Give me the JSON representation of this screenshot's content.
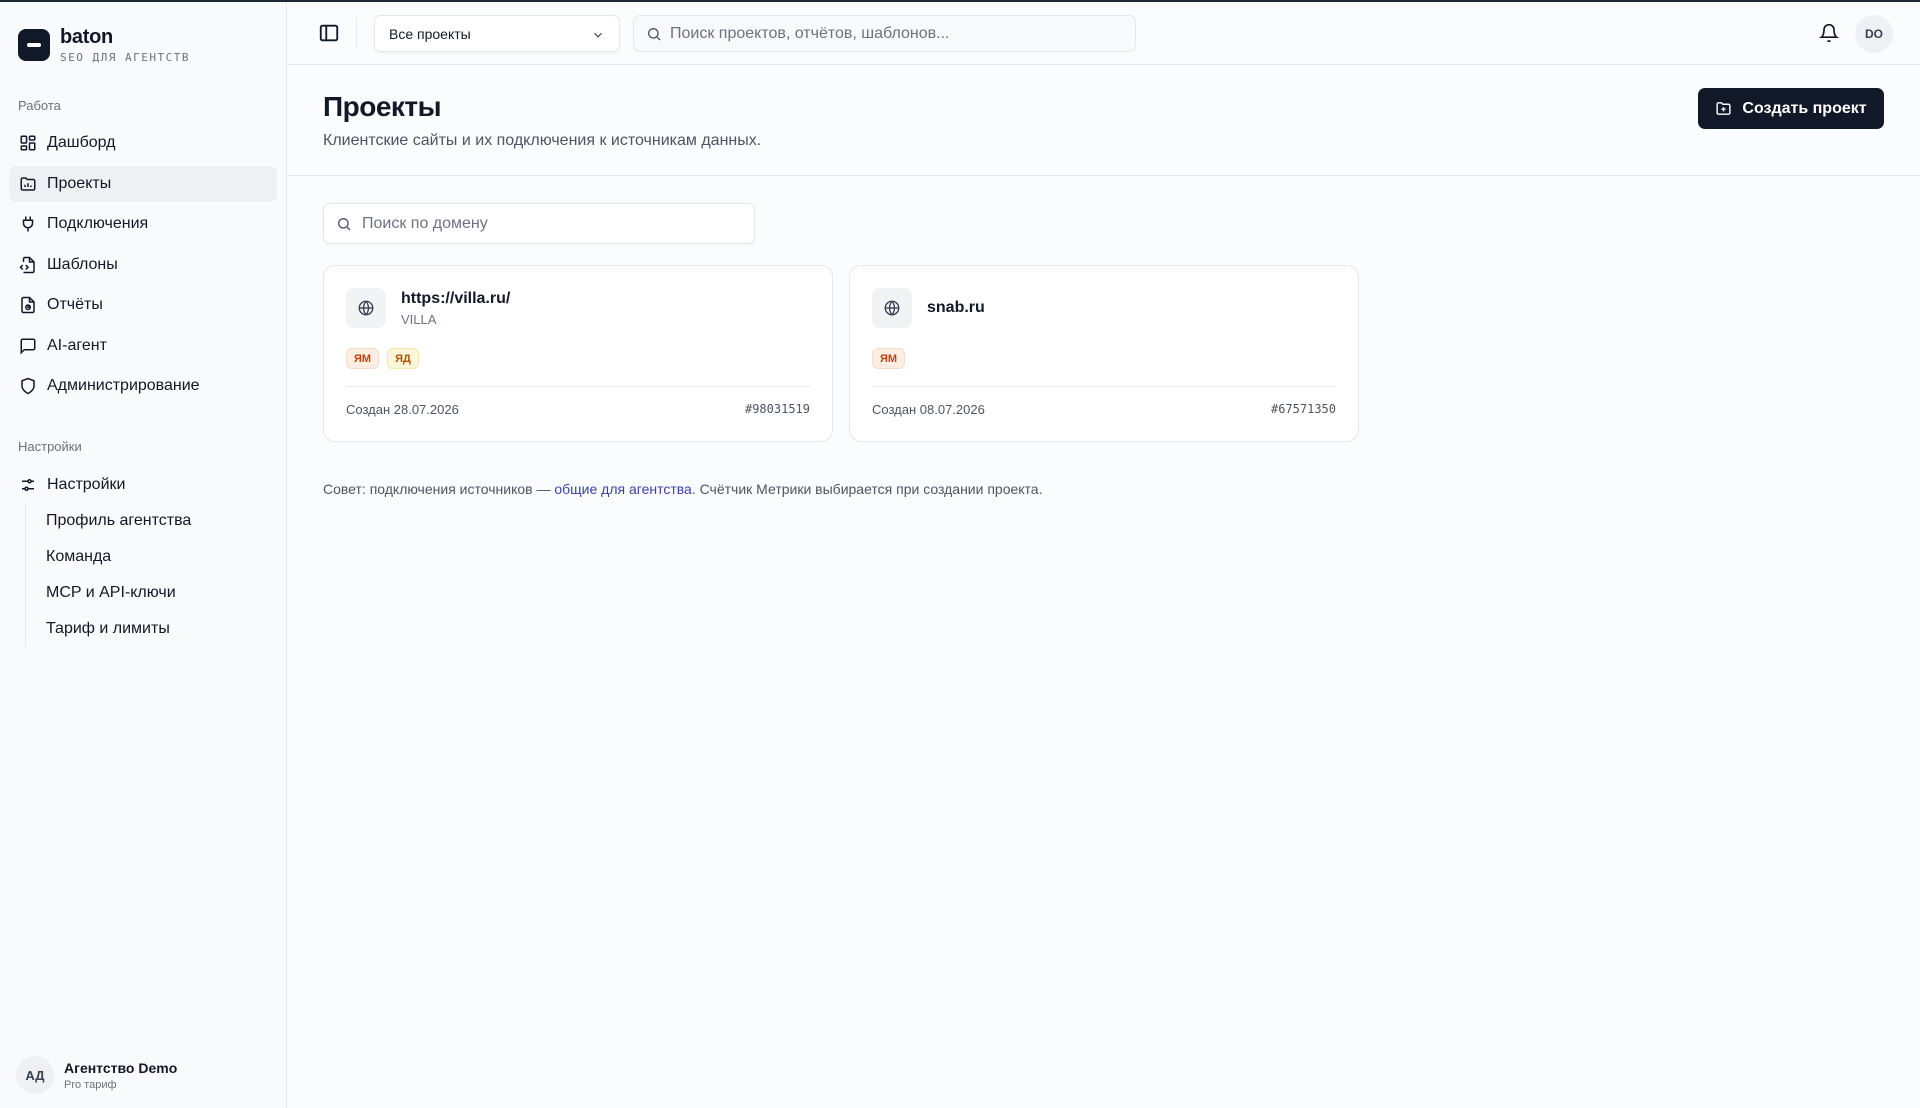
{
  "brand": {
    "name": "baton",
    "subtitle": "SEO ДЛЯ АГЕНТСТВ"
  },
  "sidebar": {
    "work_label": "Работа",
    "work_items": [
      {
        "label": "Дашборд",
        "icon": "dashboard-icon"
      },
      {
        "label": "Проекты",
        "icon": "folder-icon",
        "active": true
      },
      {
        "label": "Подключения",
        "icon": "plug-icon"
      },
      {
        "label": "Шаблоны",
        "icon": "file-code-icon"
      },
      {
        "label": "Отчёты",
        "icon": "report-icon"
      },
      {
        "label": "AI-агент",
        "icon": "chat-icon"
      },
      {
        "label": "Администрирование",
        "icon": "shield-icon"
      }
    ],
    "settings_label": "Настройки",
    "settings_item": {
      "label": "Настройки",
      "icon": "sliders-icon"
    },
    "settings_subitems": [
      {
        "label": "Профиль агентства"
      },
      {
        "label": "Команда"
      },
      {
        "label": "MCP и API-ключи"
      },
      {
        "label": "Тариф и лимиты"
      }
    ]
  },
  "account": {
    "initials": "АД",
    "name": "Агентство Demo",
    "plan": "Pro тариф"
  },
  "topbar": {
    "project_select": "Все проекты",
    "search_placeholder": "Поиск проектов, отчётов, шаблонов...",
    "user_initials": "DO"
  },
  "page": {
    "title": "Проекты",
    "description": "Клиентские сайты и их подключения к источникам данных.",
    "create_label": "Создать проект",
    "domain_search_placeholder": "Поиск по домену"
  },
  "projects": [
    {
      "domain": "https://villa.ru/",
      "name": "VILLA",
      "badges": [
        "ЯМ",
        "ЯД"
      ],
      "created": "Создан 28.07.2026",
      "id": "#98031519"
    },
    {
      "domain": "snab.ru",
      "name": "",
      "badges": [
        "ЯМ"
      ],
      "created": "Создан 08.07.2026",
      "id": "#67571350"
    }
  ],
  "tip": {
    "prefix": "Совет: подключения источников — ",
    "link": "общие для агентства",
    "suffix": ". Счётчик Метрики выбирается при создании проекта."
  },
  "colors": {
    "primary": "#111827",
    "link": "#3b3fa8",
    "badge_ym": "#c2410c",
    "badge_yd": "#b45309"
  }
}
